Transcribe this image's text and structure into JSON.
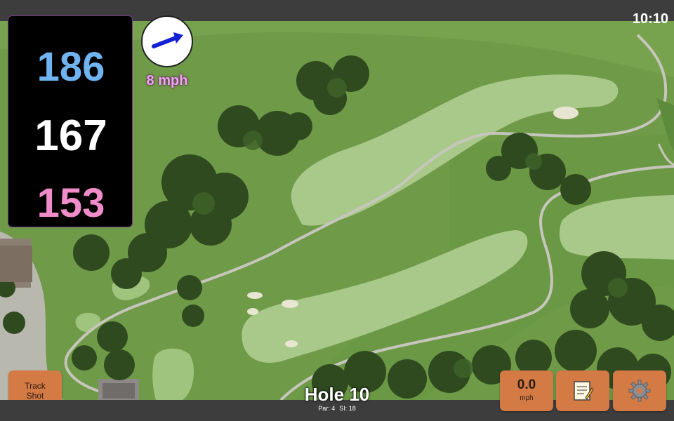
{
  "clock": "10:10",
  "yardages": {
    "back": "186",
    "middle": "167",
    "front": "153"
  },
  "wind": {
    "speed": "8 mph",
    "direction_icon": "arrow-east-icon"
  },
  "track_shot": {
    "line1": "Track",
    "line2": "Shot"
  },
  "hole": {
    "title": "Hole 10",
    "par": "Par: 4",
    "si": "SI: 18"
  },
  "speed": {
    "value": "0.0",
    "unit": "mph"
  },
  "icons": {
    "notes": "notepad-icon",
    "settings": "gear-icon"
  },
  "colors": {
    "button": "#d47a45",
    "back_yardage": "#6fb3f0",
    "front_yardage": "#f08cc9",
    "wind_text": "#f0a7f0"
  }
}
